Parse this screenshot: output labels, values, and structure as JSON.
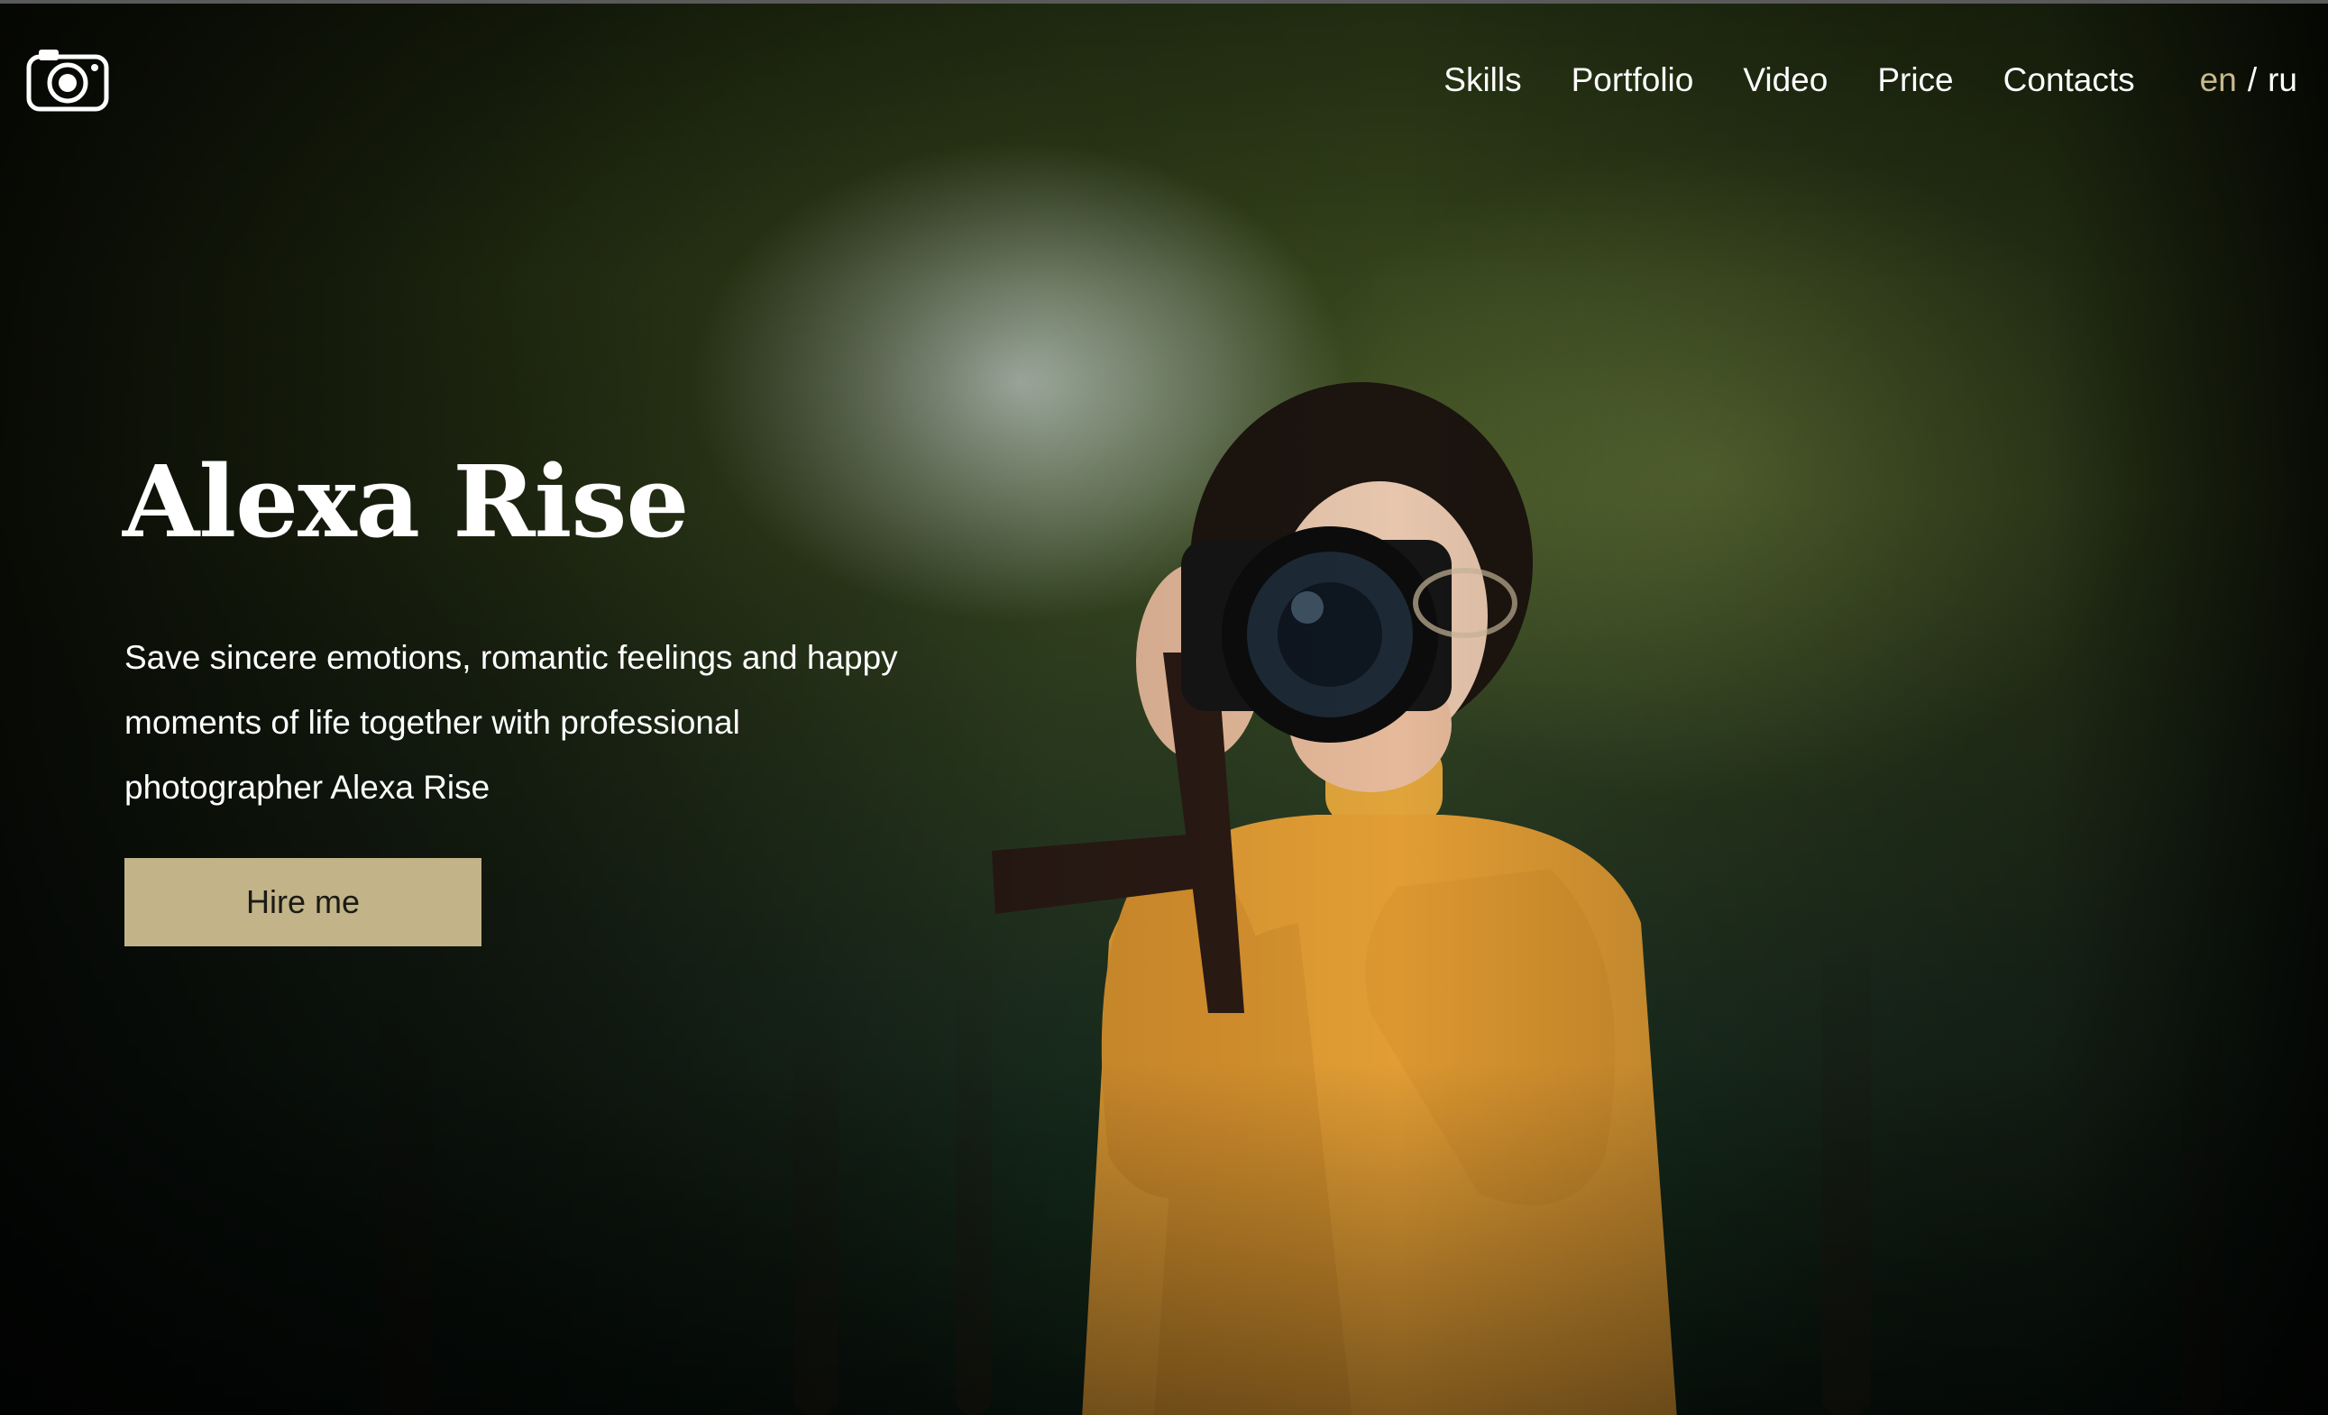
{
  "header": {
    "logo_icon": "camera-icon",
    "nav": [
      {
        "label": "Skills"
      },
      {
        "label": "Portfolio"
      },
      {
        "label": "Video"
      },
      {
        "label": "Price"
      },
      {
        "label": "Contacts"
      }
    ],
    "lang": {
      "active": "en",
      "separator": "/",
      "other": "ru"
    }
  },
  "hero": {
    "title": "Alexa Rise",
    "subtitle": "Save sincere emotions, romantic feelings and happy moments of life together with professional photographer Alexa Rise",
    "cta_label": "Hire me"
  },
  "colors": {
    "accent": "#c2b388",
    "lang_active": "#c8b98c",
    "text": "#ffffff"
  }
}
